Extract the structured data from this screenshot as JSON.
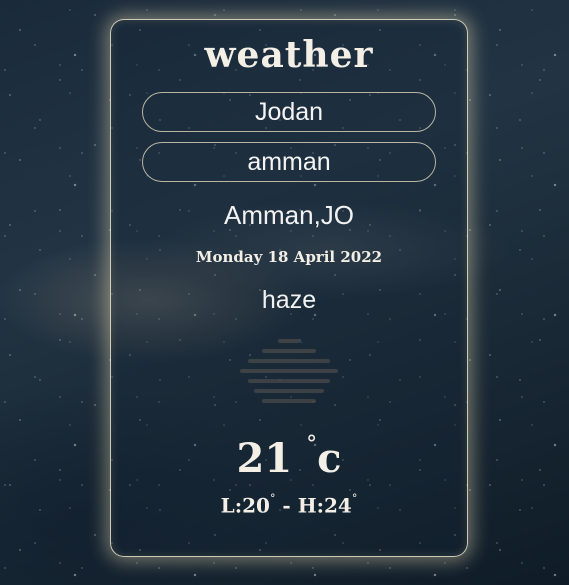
{
  "app": {
    "title": "weather"
  },
  "search": {
    "country_value": "Jodan",
    "city_value": "amman"
  },
  "weather": {
    "location": "Amman,JO",
    "date": "Monday 18 April 2022",
    "condition": "haze",
    "condition_icon": "haze-icon",
    "temperature": "21",
    "temperature_unit": "c",
    "low_label": "L:20",
    "high_label": "H:24",
    "range_separator": " - ",
    "degree_symbol": "°"
  },
  "colors": {
    "card_border": "#f0e8cd",
    "text": "#f3efe6",
    "haze_lines": "#4a4a4a"
  }
}
